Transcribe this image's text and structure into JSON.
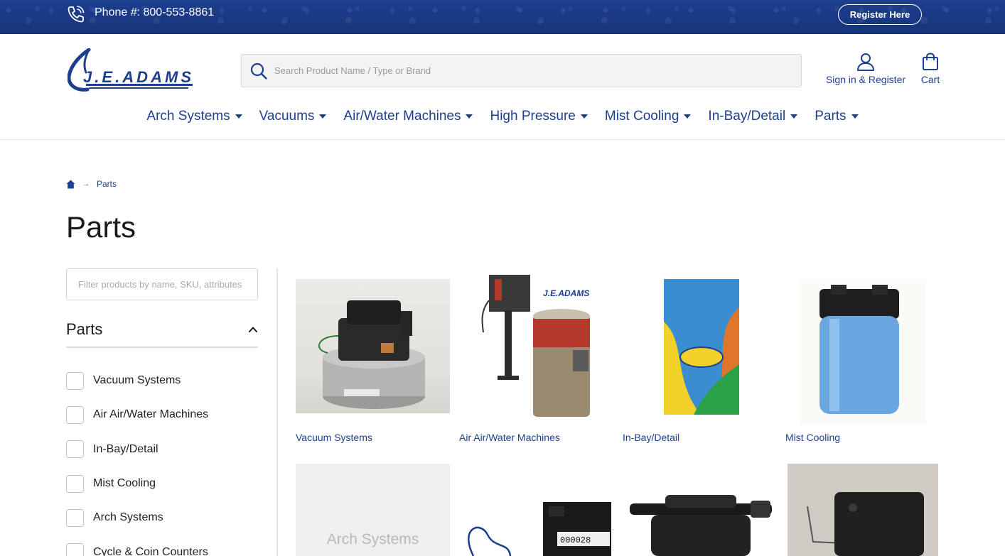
{
  "topbar": {
    "phone": "Phone #: 800-553-8861",
    "register_label": "Register Here"
  },
  "header": {
    "search_placeholder": "Search Product Name / Type or Brand",
    "account_label": "Sign in & Register",
    "cart_label": "Cart"
  },
  "nav": {
    "items": [
      {
        "label": "Arch Systems"
      },
      {
        "label": "Vacuums"
      },
      {
        "label": "Air/Water Machines"
      },
      {
        "label": "High Pressure"
      },
      {
        "label": "Mist Cooling"
      },
      {
        "label": "In-Bay/Detail"
      },
      {
        "label": "Parts"
      }
    ]
  },
  "breadcrumb": {
    "current": "Parts"
  },
  "page": {
    "title": "Parts"
  },
  "sidebar": {
    "filter_placeholder": "Filter products by name, SKU, attributes",
    "facet_title": "Parts",
    "facets": [
      {
        "label": "Vacuum Systems"
      },
      {
        "label": "Air Air/Water Machines"
      },
      {
        "label": "In-Bay/Detail"
      },
      {
        "label": "Mist Cooling"
      },
      {
        "label": "Arch Systems"
      },
      {
        "label": "Cycle & Coin Counters"
      }
    ]
  },
  "products": [
    {
      "caption": "Vacuum Systems"
    },
    {
      "caption": "Air Air/Water Machines"
    },
    {
      "caption": "In-Bay/Detail"
    },
    {
      "caption": "Mist Cooling"
    },
    {
      "placeholder": "Arch Systems"
    }
  ],
  "colors": {
    "brand": "#1d3f8f",
    "topbar": "#17347a"
  }
}
